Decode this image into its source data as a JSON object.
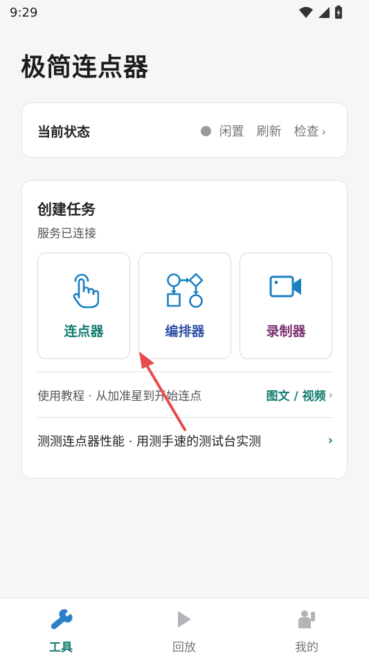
{
  "status_bar": {
    "time": "9:29"
  },
  "app": {
    "title": "极简连点器"
  },
  "status_card": {
    "title": "当前状态",
    "state": "闲置",
    "refresh": "刷新",
    "check": "检查"
  },
  "task_card": {
    "title": "创建任务",
    "subtitle": "服务已连接",
    "tools": [
      {
        "label": "连点器",
        "icon": "tap-hand-icon",
        "color": "#127a70"
      },
      {
        "label": "编排器",
        "icon": "flowchart-icon",
        "color": "#2f53a6"
      },
      {
        "label": "录制器",
        "icon": "video-camera-icon",
        "color": "#7b2f6e"
      }
    ],
    "tutorial_text": "使用教程 · 从加准星到开始连点",
    "tutorial_link": "图文 / 视频",
    "benchmark_text": "测测连点器性能 · 用测手速的测试台实测"
  },
  "bottom_nav": {
    "tools": "工具",
    "playback": "回放",
    "mine": "我的"
  },
  "colors": {
    "accent": "#127a70",
    "blue": "#2f53a6",
    "purple": "#7b2f6e",
    "arrow": "#e84b4b"
  }
}
